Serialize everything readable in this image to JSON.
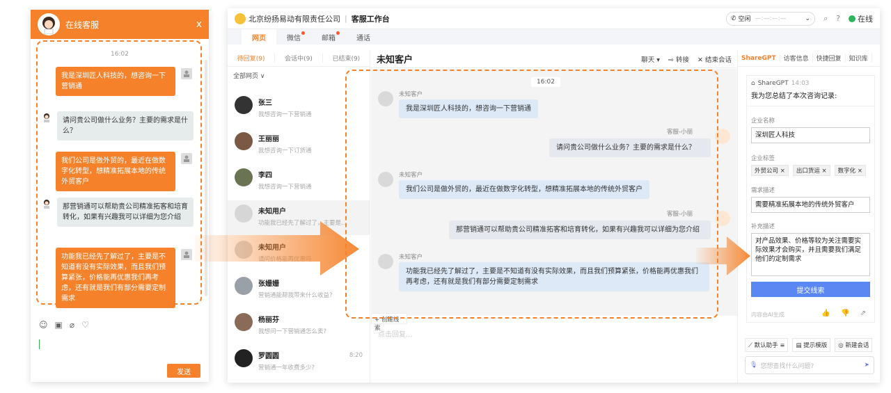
{
  "widget": {
    "title": "在线客服",
    "close": "x",
    "time": "16:02",
    "messages": [
      {
        "from": "customer",
        "text": "我是深圳匠人科技的，想咨询一下营销通"
      },
      {
        "from": "agent",
        "text": "请问贵公司做什么业务？主要的需求是什么？"
      },
      {
        "from": "customer",
        "text": "我们公司是做外贸的，最近在做数字化转型，想精准拓展本地的传统外贸客户"
      },
      {
        "from": "agent",
        "text": "那营销通可以帮助贵公司精准拓客和培育转化，如果有兴趣我可以详细为您介绍"
      },
      {
        "from": "customer",
        "text": "功能我已经先了解过了，主要是不知道有没有实际效果，而且我们预算紧张，价格能再优惠我们再考虑，还有就是我们有部分需要定制需求"
      }
    ],
    "tool_icons": [
      "smile-icon",
      "image-icon",
      "attach-icon",
      "heart-icon"
    ],
    "send_label": "发送"
  },
  "topbar": {
    "company": "北京纷扬易动有限责任公司",
    "separator": "|",
    "title": "客服工作台",
    "status_label": "空闲",
    "status_placeholder": "—:—:—:—",
    "online_label": "在线"
  },
  "tabs": [
    "网页",
    "微信",
    "邮箱",
    "通话"
  ],
  "list": {
    "subtabs": [
      "待回复(9)",
      "会话中(9)",
      "已结束(9)"
    ],
    "filter": "全部网页 ∨",
    "contacts": [
      {
        "name": "张三",
        "sub": "我想咨询一下营销通",
        "time": ""
      },
      {
        "name": "王丽丽",
        "sub": "我想咨询一下订货通",
        "time": ""
      },
      {
        "name": "李四",
        "sub": "我想咨询一下营销通",
        "time": ""
      },
      {
        "name": "未知用户",
        "sub": "功能我已经先了解过了，主要是不通...",
        "time": ""
      },
      {
        "name": "未知用户",
        "sub": "请问价格能再优惠吗",
        "time": ""
      },
      {
        "name": "张姗姗",
        "sub": "营销通能帮我带来什么收益?",
        "time": ""
      },
      {
        "name": "杨丽芬",
        "sub": "我想问一下营销通怎么卖?",
        "time": ""
      },
      {
        "name": "罗圆圆",
        "sub": "营销通一年收费多少?",
        "time": "8:20"
      }
    ]
  },
  "chat": {
    "name": "未知客户",
    "actions": [
      "聊天 ▾",
      "⇨ 转接",
      "✕ 结束会话"
    ],
    "time": "16:02",
    "customer_label": "未知客户",
    "agent_label": "客服-小丽",
    "messages": [
      {
        "from": "customer",
        "text": "我是深圳匠人科技的，想咨询一下营销通"
      },
      {
        "from": "agent",
        "text": "请问贵公司做什么业务？主要的需求是什么？"
      },
      {
        "from": "customer",
        "text": "我们公司是做外贸的，最近在做数字化转型，想精准拓展本地的传统外贸客户"
      },
      {
        "from": "agent",
        "text": "那营销通可以帮助贵公司精准拓客和培育转化，如果有兴趣我可以详细为您介绍"
      },
      {
        "from": "customer",
        "text": "功能我已经先了解过了，主要是不知道有没有实际效果，而且我们预算紧张，价格能再优惠我们再考虑，还有就是我们有部分需要定制需求"
      }
    ],
    "new_lead": "+ 创建线索",
    "reply_placeholder": "点击回复..."
  },
  "side": {
    "tabs": [
      "ShareGPT",
      "访客信息",
      "快捷回复",
      "知识库"
    ],
    "summary": {
      "source": "ShareGPT",
      "time": "14:03",
      "intro": "我为您总结了本次咨询记录:",
      "company_label": "企业名称",
      "company": "深圳匠人科技",
      "tags_label": "企业标签",
      "tags": [
        "外贸公司 ×",
        "出口货运 ×",
        "数字化 ×"
      ],
      "need_label": "需求描述",
      "need": "需要精准拓展本地的传统外贸客户",
      "extra_label": "补充描述",
      "extra": "对产品效果、价格等较为关注需要实际效果才会购买，并且需要我们满足他们的定制需求",
      "submit": "提交线索",
      "ai_note": "内容由AI生成",
      "ai_icons": "👍 👎 ⇗"
    },
    "buttons": [
      "⟋ 默认助手 ≡",
      "▤ 提示模版",
      "◎ 新建会话"
    ],
    "ask_placeholder": "您想查找什么问题?"
  },
  "colors": {
    "accent": "#f5822a",
    "primary": "#5b87f2",
    "online": "#2db55d"
  }
}
